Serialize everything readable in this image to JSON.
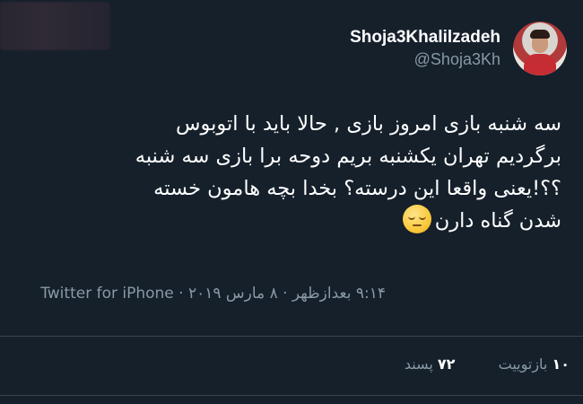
{
  "user": {
    "display_name": "Shoja3Khalilzadeh",
    "handle": "@Shoja3Kh"
  },
  "tweet": {
    "text": "سه شنبه بازی امروز بازی , حالا باید با اتوبوس\nبرگردیم تهران یکشنبه بریم  دوحه برا بازی سه شنبه\n؟؟!یعنی واقعا این درسته؟ بخدا بچه هامون خسته\nشدن گناه دارن",
    "emoji_icon": "pensive-face-icon"
  },
  "meta": {
    "time": "۹:۱۴ بعدازظهر",
    "date": "۸ مارس ۲۰۱۹",
    "separator": "·",
    "source": "Twitter for iPhone"
  },
  "stats": {
    "retweets_count": "۱۰",
    "retweets_label": "بازتوییت",
    "likes_count": "۷۲",
    "likes_label": "پسند"
  },
  "colors": {
    "background": "#15202b",
    "secondary_text": "#8899a6",
    "divider": "#38444d"
  }
}
